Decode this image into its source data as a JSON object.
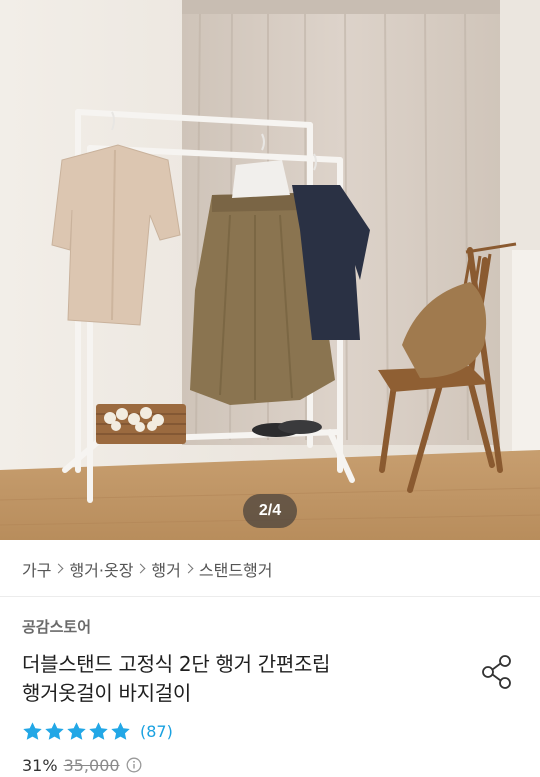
{
  "image": {
    "counter": "2/4",
    "colors": {
      "wall": "#efeae3",
      "curtain": "#d9cfc6",
      "floor": "#c49b6a",
      "rack": "#f3f1ee"
    }
  },
  "breadcrumb": [
    "가구",
    "행거·옷장",
    "행거",
    "스탠드행거"
  ],
  "store": "공감스토어",
  "product": {
    "title_line1": "더블스탠드 고정식 2단 행거 간편조립",
    "title_line2": "행거옷걸이 바지걸이"
  },
  "rating": {
    "stars": 5,
    "review_count": "(87)",
    "star_color": "#22a7e6"
  },
  "price": {
    "discount": "31%",
    "original": "35,000"
  },
  "icons": {
    "share": "share-icon",
    "info": "info-icon"
  }
}
